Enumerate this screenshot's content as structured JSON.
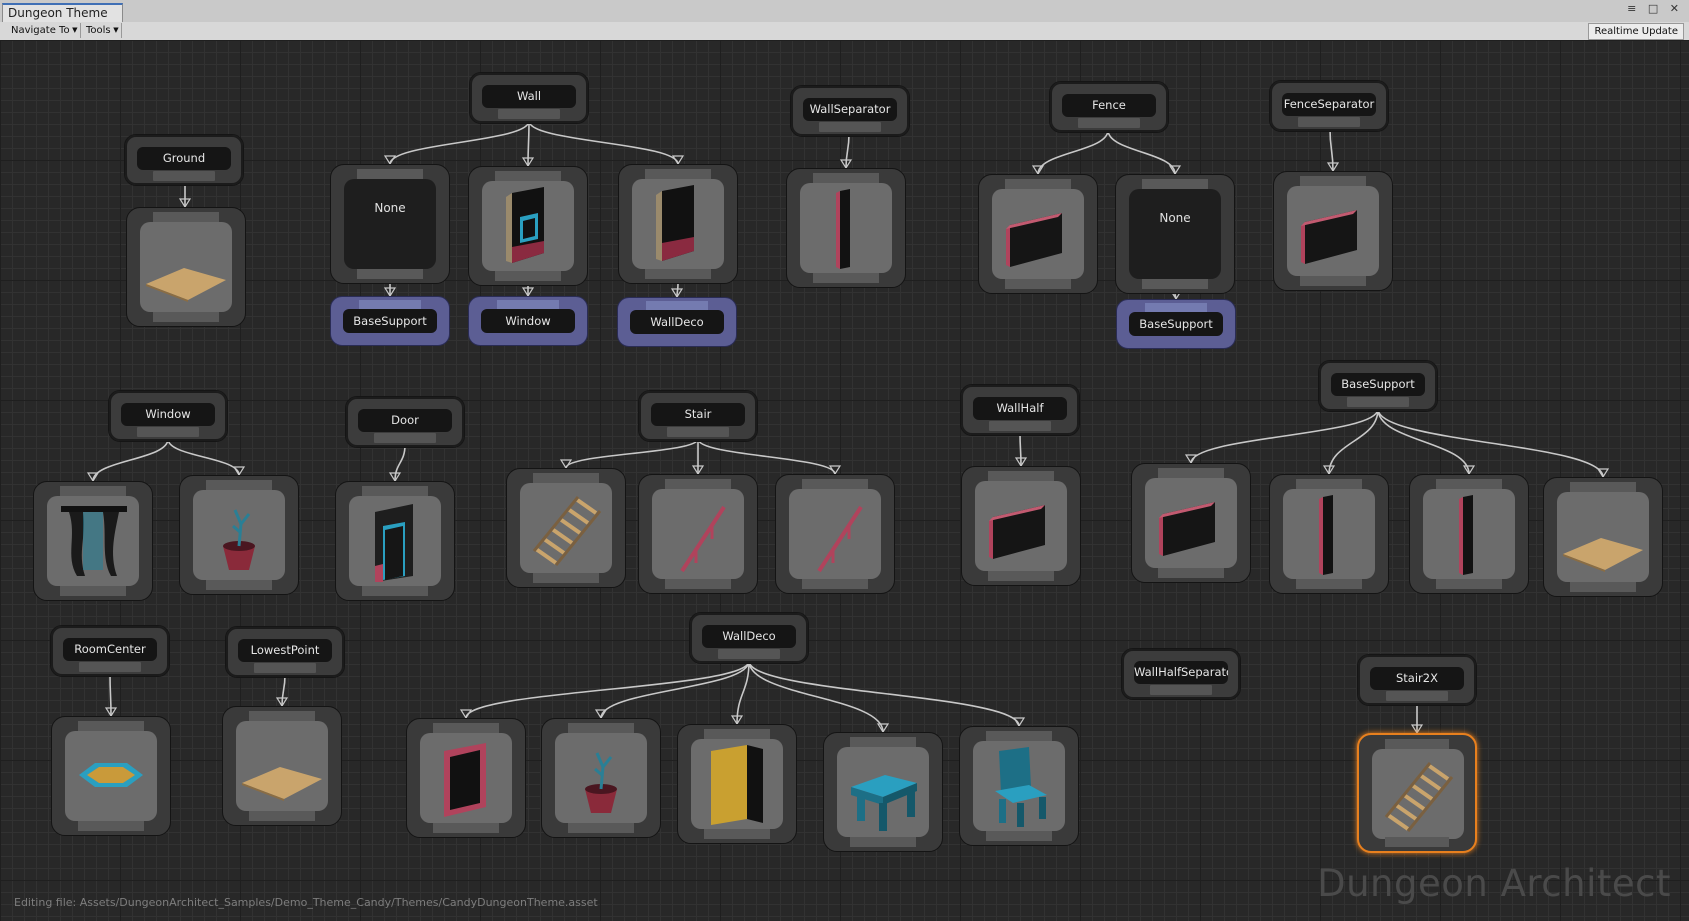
{
  "window": {
    "tab_title": "Dungeon Theme",
    "controls": "≡ □ ✕"
  },
  "toolbar": {
    "navigate_label": "Navigate To",
    "tools_label": "Tools",
    "realtime_label": "Realtime Update"
  },
  "status": {
    "editing_file": "Editing file: Assets/DungeonArchitect_Samples/Demo_Theme_Candy/Themes/CandyDungeonTheme.asset"
  },
  "watermark": "Dungeon Architect",
  "graph": {
    "markers": [
      {
        "label": "Ground"
      },
      {
        "label": "Wall"
      },
      {
        "label": "WallSeparator"
      },
      {
        "label": "Fence"
      },
      {
        "label": "FenceSeparator"
      },
      {
        "label": "Window"
      },
      {
        "label": "Door"
      },
      {
        "label": "Stair"
      },
      {
        "label": "WallHalf"
      },
      {
        "label": "BaseSupport"
      },
      {
        "label": "RoomCenter"
      },
      {
        "label": "LowestPoint"
      },
      {
        "label": "WallDeco"
      },
      {
        "label": "WallHalfSeparator"
      },
      {
        "label": "Stair2X"
      }
    ],
    "visuals": [
      {
        "id": "ground-floor",
        "kind": "floor"
      },
      {
        "id": "wall-none",
        "kind": "none",
        "label": "None"
      },
      {
        "id": "wall-window",
        "kind": "wall-window"
      },
      {
        "id": "wall-plain",
        "kind": "wall"
      },
      {
        "id": "wallsep-pillar",
        "kind": "pillar"
      },
      {
        "id": "fence-panel",
        "kind": "panel"
      },
      {
        "id": "fence-none",
        "kind": "none",
        "label": "None"
      },
      {
        "id": "fencesep-panel",
        "kind": "panel"
      },
      {
        "id": "window-curtain",
        "kind": "curtain"
      },
      {
        "id": "window-plant",
        "kind": "plant"
      },
      {
        "id": "door-frame",
        "kind": "door"
      },
      {
        "id": "stair-steps",
        "kind": "stairs"
      },
      {
        "id": "stair-rail-1",
        "kind": "rail"
      },
      {
        "id": "stair-rail-2",
        "kind": "rail"
      },
      {
        "id": "wallhalf-panel",
        "kind": "panel"
      },
      {
        "id": "basesupport-panel",
        "kind": "panel"
      },
      {
        "id": "basesupport-pillar-1",
        "kind": "pillar"
      },
      {
        "id": "basesupport-pillar-2",
        "kind": "pillar"
      },
      {
        "id": "basesupport-floor",
        "kind": "floor"
      },
      {
        "id": "roomcenter-rug",
        "kind": "rug"
      },
      {
        "id": "lowestpoint-floor",
        "kind": "floor"
      },
      {
        "id": "walldeco-frame",
        "kind": "frame"
      },
      {
        "id": "walldeco-plant",
        "kind": "plant"
      },
      {
        "id": "walldeco-cabinet",
        "kind": "cabinet"
      },
      {
        "id": "walldeco-table",
        "kind": "table"
      },
      {
        "id": "walldeco-chair",
        "kind": "chair"
      },
      {
        "id": "stair2x-steps",
        "kind": "stairs",
        "selected": true
      }
    ],
    "emitted": [
      {
        "label": "BaseSupport"
      },
      {
        "label": "Window"
      },
      {
        "label": "WallDeco"
      },
      {
        "label": "BaseSupport"
      }
    ]
  },
  "colors": {
    "accent_selected": "#e8801e",
    "marker_emitter": "#5c5e94",
    "wire": "#c8c8c8"
  }
}
